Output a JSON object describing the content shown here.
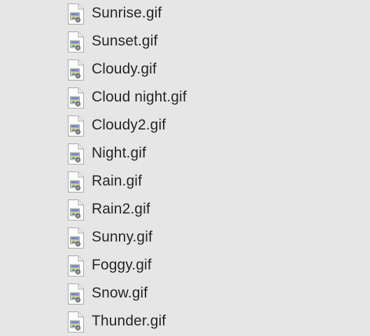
{
  "files": [
    {
      "name": "Sunrise.gif",
      "icon": "gif-file-icon"
    },
    {
      "name": "Sunset.gif",
      "icon": "gif-file-icon"
    },
    {
      "name": "Cloudy.gif",
      "icon": "gif-file-icon"
    },
    {
      "name": "Cloud night.gif",
      "icon": "gif-file-icon"
    },
    {
      "name": "Cloudy2.gif",
      "icon": "gif-file-icon"
    },
    {
      "name": "Night.gif",
      "icon": "gif-file-icon"
    },
    {
      "name": "Rain.gif",
      "icon": "gif-file-icon"
    },
    {
      "name": "Rain2.gif",
      "icon": "gif-file-icon"
    },
    {
      "name": "Sunny.gif",
      "icon": "gif-file-icon"
    },
    {
      "name": "Foggy.gif",
      "icon": "gif-file-icon"
    },
    {
      "name": "Snow.gif",
      "icon": "gif-file-icon"
    },
    {
      "name": "Thunder.gif",
      "icon": "gif-file-icon"
    }
  ],
  "colors": {
    "background": "#e6e6e6",
    "text": "#262626"
  }
}
